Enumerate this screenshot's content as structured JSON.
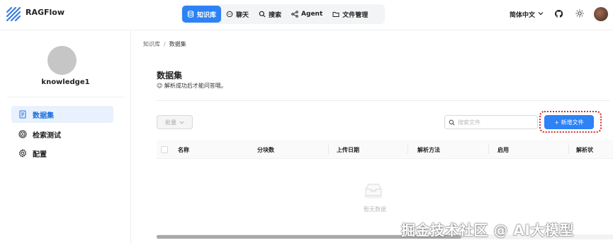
{
  "app": {
    "name": "RAGFlow"
  },
  "nav": {
    "items": [
      {
        "label": "知识库",
        "icon": "database-icon",
        "active": true
      },
      {
        "label": "聊天",
        "icon": "chat-icon",
        "active": false
      },
      {
        "label": "搜索",
        "icon": "search-icon",
        "active": false
      },
      {
        "label": "Agent",
        "icon": "agent-icon",
        "active": false
      },
      {
        "label": "文件管理",
        "icon": "folder-icon",
        "active": false
      }
    ],
    "language": "简体中文"
  },
  "sidebar": {
    "kb_name": "knowledge1",
    "items": [
      {
        "label": "数据集",
        "icon": "document-icon",
        "active": true
      },
      {
        "label": "检索测试",
        "icon": "target-icon",
        "active": false
      },
      {
        "label": "配置",
        "icon": "gear-icon",
        "active": false
      }
    ]
  },
  "breadcrumb": {
    "root": "知识库",
    "current": "数据集"
  },
  "main": {
    "title": "数据集",
    "subtitle": "😉 解析成功后才能问答哦。",
    "batch_label": "批量",
    "search_placeholder": "搜索文件",
    "new_file_label": "+ 新增文件",
    "columns": [
      "名称",
      "分块数",
      "上传日期",
      "解析方法",
      "启用",
      "解析状"
    ],
    "empty_text": "暂无数据"
  },
  "watermark": "掘金技术社区 @ AI大模型",
  "colors": {
    "accent": "#2d82f5",
    "highlight": "#d62b2b"
  }
}
